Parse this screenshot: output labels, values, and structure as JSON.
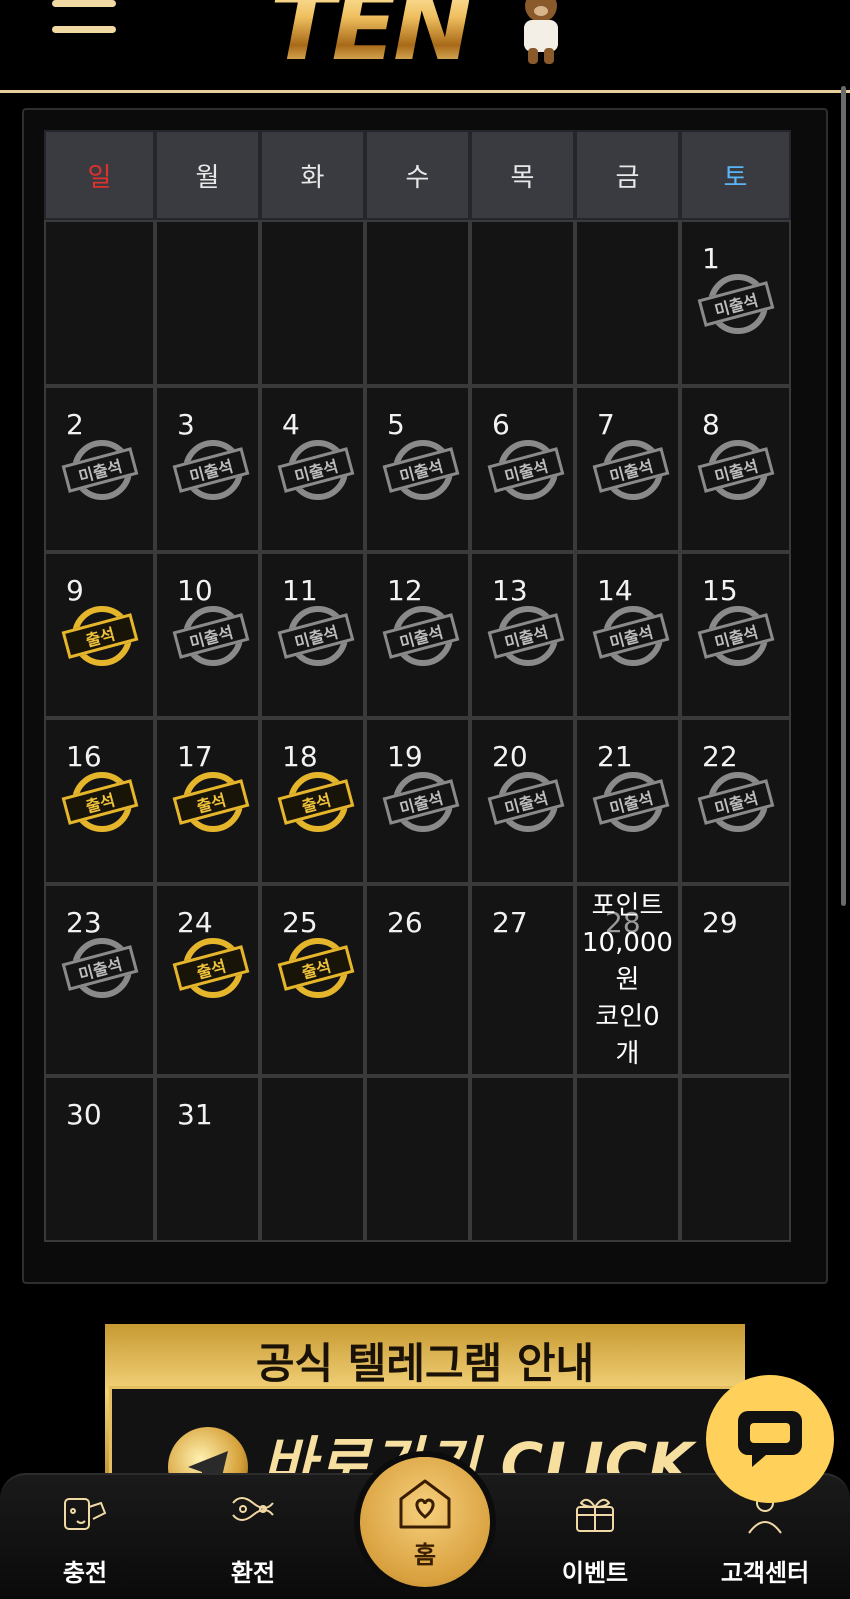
{
  "header": {
    "logo_text": "TEN",
    "menu_icon": "hamburger-menu-icon"
  },
  "calendar": {
    "weekdays": [
      "일",
      "월",
      "화",
      "수",
      "목",
      "금",
      "토"
    ],
    "stamp_labels": {
      "absent": "미출석",
      "present": "출석"
    },
    "weeks": [
      [
        null,
        null,
        null,
        null,
        null,
        null,
        {
          "day": "1",
          "status": "absent"
        }
      ],
      [
        {
          "day": "2",
          "status": "absent"
        },
        {
          "day": "3",
          "status": "absent"
        },
        {
          "day": "4",
          "status": "absent"
        },
        {
          "day": "5",
          "status": "absent"
        },
        {
          "day": "6",
          "status": "absent"
        },
        {
          "day": "7",
          "status": "absent"
        },
        {
          "day": "8",
          "status": "absent"
        }
      ],
      [
        {
          "day": "9",
          "status": "present"
        },
        {
          "day": "10",
          "status": "absent"
        },
        {
          "day": "11",
          "status": "absent"
        },
        {
          "day": "12",
          "status": "absent"
        },
        {
          "day": "13",
          "status": "absent"
        },
        {
          "day": "14",
          "status": "absent"
        },
        {
          "day": "15",
          "status": "absent"
        }
      ],
      [
        {
          "day": "16",
          "status": "present"
        },
        {
          "day": "17",
          "status": "present"
        },
        {
          "day": "18",
          "status": "present"
        },
        {
          "day": "19",
          "status": "absent"
        },
        {
          "day": "20",
          "status": "absent"
        },
        {
          "day": "21",
          "status": "absent"
        },
        {
          "day": "22",
          "status": "absent"
        }
      ],
      [
        {
          "day": "23",
          "status": "absent"
        },
        {
          "day": "24",
          "status": "present"
        },
        {
          "day": "25",
          "status": "present"
        },
        {
          "day": "26",
          "status": null
        },
        {
          "day": "27",
          "status": null
        },
        {
          "day": "28",
          "status": null,
          "reward": [
            "포인트",
            "10,000",
            "원",
            "코인0",
            "개"
          ]
        },
        {
          "day": "29",
          "status": null
        }
      ],
      [
        {
          "day": "30",
          "status": null
        },
        {
          "day": "31",
          "status": null
        },
        null,
        null,
        null,
        null,
        null
      ]
    ]
  },
  "banner": {
    "title": "공식 텔레그램 안내",
    "cta": "바로가기 CLICK",
    "icon": "telegram-icon"
  },
  "chat": {
    "icon": "chat-bubble-icon"
  },
  "bottom_nav": {
    "items": [
      {
        "label": "충전",
        "icon": "charge-icon"
      },
      {
        "label": "환전",
        "icon": "exchange-icon"
      },
      {
        "label": "홈",
        "icon": "home-heart-icon"
      },
      {
        "label": "이벤트",
        "icon": "gift-icon"
      },
      {
        "label": "고객센터",
        "icon": "support-icon"
      }
    ]
  },
  "colors": {
    "accent_gold": "#e5b52c",
    "sunday_red": "#e0302b",
    "saturday_blue": "#5ab4f5",
    "absent_gray": "#8a8a8a",
    "header_line": "#e6cf9d"
  }
}
